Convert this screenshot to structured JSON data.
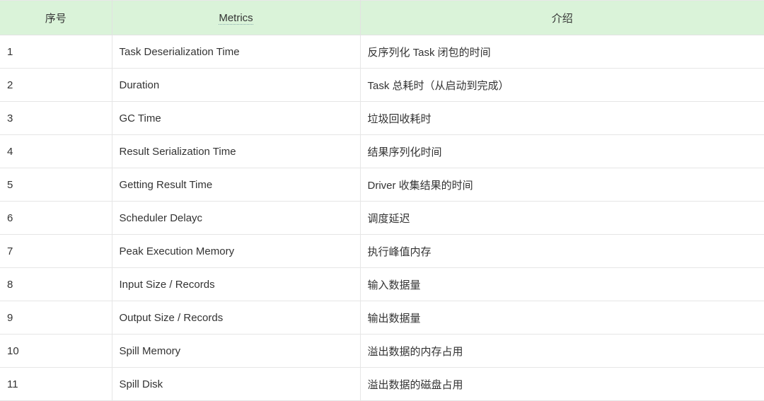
{
  "headers": [
    "序号",
    "Metrics",
    "介绍"
  ],
  "rows": [
    {
      "n": "1",
      "metric": "Task Deserialization Time",
      "desc": "反序列化 Task 闭包的时间"
    },
    {
      "n": "2",
      "metric": "Duration",
      "desc": "Task 总耗时（从启动到完成）"
    },
    {
      "n": "3",
      "metric": "GC Time",
      "desc": "垃圾回收耗时"
    },
    {
      "n": "4",
      "metric": "Result Serialization Time",
      "desc": "结果序列化时间"
    },
    {
      "n": "5",
      "metric": "Getting Result Time",
      "desc": "Driver 收集结果的时间"
    },
    {
      "n": "6",
      "metric": "Scheduler Delayc",
      "desc": "调度延迟"
    },
    {
      "n": "7",
      "metric": "Peak Execution Memory",
      "desc": "执行峰值内存"
    },
    {
      "n": "8",
      "metric": "Input Size / Records",
      "desc": "输入数据量"
    },
    {
      "n": "9",
      "metric": "Output Size / Records",
      "desc": "输出数据量"
    },
    {
      "n": "10",
      "metric": "Spill Memory",
      "desc": "溢出数据的内存占用"
    },
    {
      "n": "11",
      "metric": "Spill Disk",
      "desc": "溢出数据的磁盘占用"
    }
  ]
}
